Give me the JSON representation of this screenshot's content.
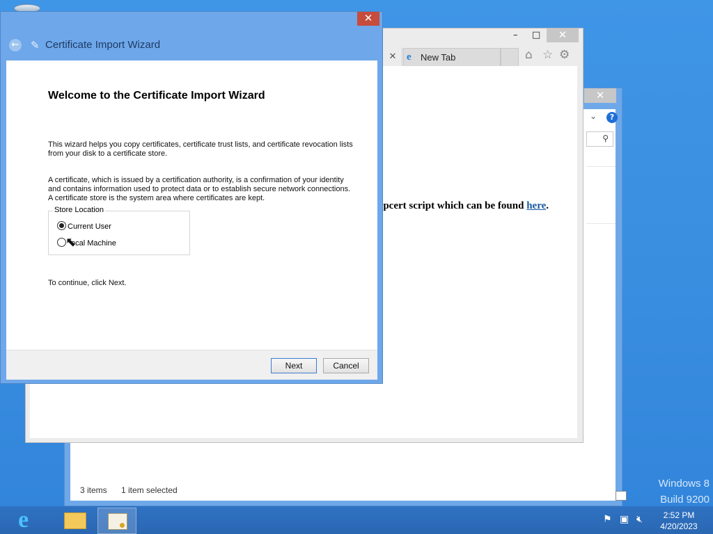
{
  "desktop": {
    "watermark": {
      "line1": "Windows 8",
      "line2": "Build 9200"
    }
  },
  "explorer": {
    "close_glyph": "✕",
    "status": {
      "items": "3 items",
      "selected": "1 item selected"
    }
  },
  "ie": {
    "controls": {
      "minimize": "–",
      "maximize": "□",
      "close": "✕"
    },
    "tab_close": "✕",
    "tab": {
      "label": "New Tab"
    },
    "page_text": "upcert script which can be found",
    "page_link": "here",
    "page_end": "."
  },
  "wizard": {
    "title": "Certificate Import Wizard",
    "close_glyph": "✕",
    "heading": "Welcome to the Certificate Import Wizard",
    "para1": "This wizard helps you copy certificates, certificate trust lists, and certificate revocation lists from your disk to a certificate store.",
    "para2": "A certificate, which is issued by a certification authority, is a confirmation of your identity and contains information used to protect data or to establish secure network connections. A certificate store is the system area where certificates are kept.",
    "store_location": {
      "legend": "Store Location",
      "options": [
        {
          "label": "Current User",
          "selected": true
        },
        {
          "label": "ocal Machine",
          "selected": false
        }
      ]
    },
    "continue_text": "To continue, click Next.",
    "buttons": {
      "next": "Next",
      "cancel": "Cancel"
    }
  },
  "taskbar": {
    "clock": {
      "time": "2:52 PM",
      "date": "4/20/2023"
    }
  },
  "colors": {
    "desktop": "#3b8de0",
    "taskbar": "#2f72c2",
    "window_frame": "#6ea7ea",
    "close_button": "#c74c3c",
    "link": "#1a5aa0"
  }
}
